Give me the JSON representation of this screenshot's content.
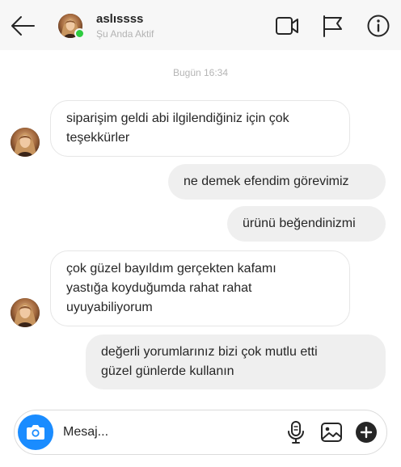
{
  "header": {
    "username": "aslıssss",
    "status": "Şu Anda Aktif",
    "icons": [
      "back-arrow-icon",
      "video-call-icon",
      "flag-icon",
      "info-icon"
    ],
    "online_color": "#2ecc40"
  },
  "conversation": {
    "timestamp": "Bugün 16:34",
    "messages": [
      {
        "from": "them",
        "lines": [
          "siparişim geldi abi ilgilendiğiniz için çok",
          "teşekkürler"
        ]
      },
      {
        "from": "me",
        "lines": [
          "ne demek efendim görevimiz"
        ]
      },
      {
        "from": "me",
        "lines": [
          "ürünü beğendinizmi"
        ]
      },
      {
        "from": "them",
        "lines": [
          "çok güzel bayıldım gerçekten kafamı",
          "yastığa koyduğumda rahat rahat",
          "uyuyabiliyorum"
        ]
      },
      {
        "from": "me",
        "lines": [
          "değerli yorumlarınız bizi çok mutlu etti",
          "güzel günlerde kullanın"
        ]
      }
    ]
  },
  "composer": {
    "placeholder": "Mesaj...",
    "icons": [
      "camera-icon",
      "microphone-icon",
      "image-icon",
      "plus-icon"
    ],
    "camera_color": "#1a8cff"
  }
}
